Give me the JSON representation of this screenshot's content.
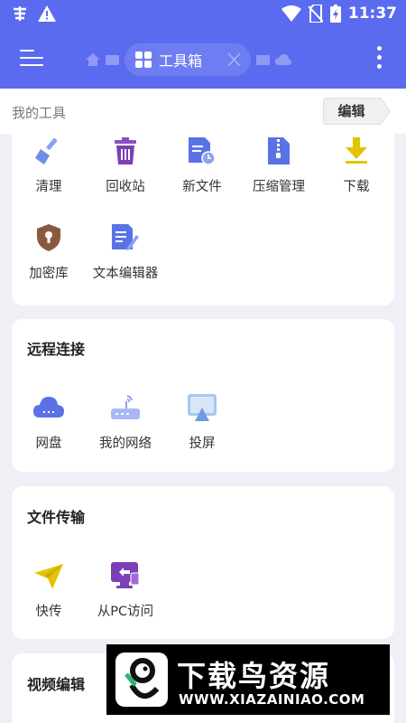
{
  "status_bar": {
    "time": "11:37"
  },
  "top_bar": {
    "active_tab": "工具箱"
  },
  "my_tools": {
    "title": "我的工具",
    "edit_label": "编辑",
    "tools": [
      {
        "label": "清理",
        "icon": "broom-icon"
      },
      {
        "label": "回收站",
        "icon": "trash-icon"
      },
      {
        "label": "新文件",
        "icon": "new-file-icon"
      },
      {
        "label": "压缩管理",
        "icon": "zip-icon"
      },
      {
        "label": "下载",
        "icon": "download-icon"
      },
      {
        "label": "加密库",
        "icon": "lock-shield-icon"
      },
      {
        "label": "文本编辑器",
        "icon": "text-editor-icon"
      }
    ]
  },
  "remote": {
    "title": "远程连接",
    "tools": [
      {
        "label": "网盘",
        "icon": "cloud-icon"
      },
      {
        "label": "我的网络",
        "icon": "router-icon"
      },
      {
        "label": "投屏",
        "icon": "screencast-icon"
      }
    ]
  },
  "transfer": {
    "title": "文件传输",
    "tools": [
      {
        "label": "快传",
        "icon": "paper-plane-icon"
      },
      {
        "label": "从PC访问",
        "icon": "pc-access-icon"
      }
    ]
  },
  "video": {
    "title": "视频编辑"
  },
  "watermark": {
    "name": "下载鸟资源",
    "url": "WWW.XIAZAINIAO.COM"
  },
  "colors": {
    "primary": "#5b6bf0",
    "icon_blue": "#5b72e6",
    "download_yellow": "#e2c400"
  }
}
